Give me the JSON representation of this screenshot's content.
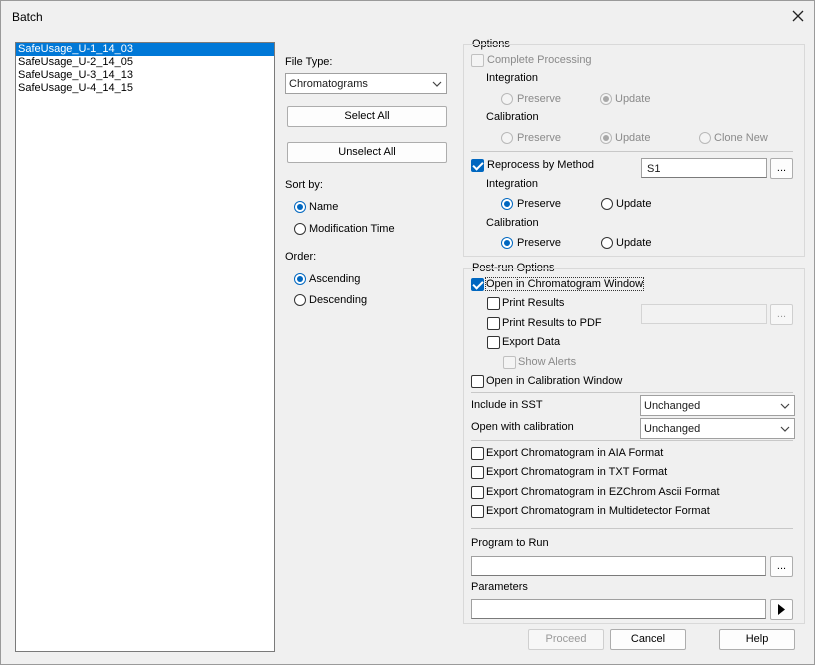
{
  "title": "Batch",
  "files": [
    "SafeUsage_U-1_14_03",
    "SafeUsage_U-2_14_05",
    "SafeUsage_U-3_14_13",
    "SafeUsage_U-4_14_15"
  ],
  "file_type": {
    "label": "File Type:",
    "value": "Chromatograms"
  },
  "buttons": {
    "select_all": "Select All",
    "unselect_all": "Unselect All",
    "proceed": "Proceed",
    "cancel": "Cancel",
    "help": "Help",
    "ellipsis": "..."
  },
  "sort_by": {
    "label": "Sort by:",
    "name": "Name",
    "modification_time": "Modification Time"
  },
  "order": {
    "label": "Order:",
    "ascending": "Ascending",
    "descending": "Descending"
  },
  "options": {
    "label": "Options",
    "complete_processing": "Complete Processing",
    "integration": "Integration",
    "calibration": "Calibration",
    "preserve": "Preserve",
    "update": "Update",
    "clone_new": "Clone New",
    "reprocess_by_method": "Reprocess by Method",
    "method_value": "S1"
  },
  "post_run": {
    "label": "Post-run Options",
    "open_chrom_window": "Open in Chromatogram Window",
    "print_results": "Print Results",
    "print_to_pdf": "Print Results to PDF",
    "export_data": "Export Data",
    "show_alerts": "Show Alerts",
    "open_calib_window": "Open in Calibration Window",
    "include_sst": "Include in SST",
    "include_sst_value": "Unchanged",
    "open_with_calibration": "Open with calibration",
    "open_with_calibration_value": "Unchanged",
    "export_aia": "Export Chromatogram in AIA Format",
    "export_txt": "Export Chromatogram in TXT Format",
    "export_ezchrom": "Export Chromatogram in EZChrom Ascii Format",
    "export_multidetector": "Export Chromatogram in Multidetector Format",
    "program_to_run": "Program to Run",
    "parameters": "Parameters"
  }
}
